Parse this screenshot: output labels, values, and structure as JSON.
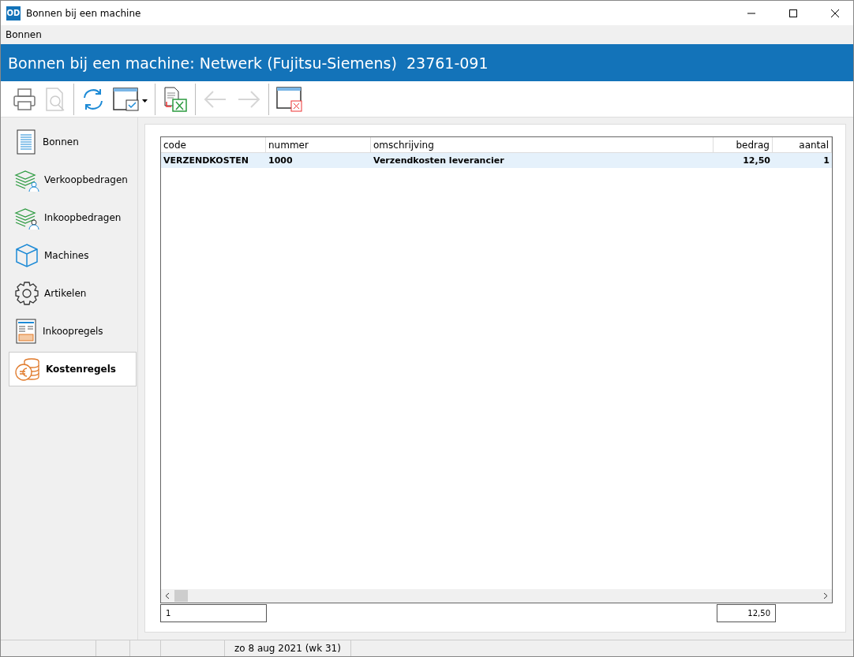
{
  "window": {
    "title": "Bonnen bij een machine",
    "app_badge": "OD"
  },
  "menu": [
    "Bonnen"
  ],
  "header": {
    "title": "Bonnen bij een machine: Netwerk (Fujitsu-Siemens)  23761-091"
  },
  "toolbar": [
    {
      "kind": "print",
      "disabled": false
    },
    {
      "kind": "preview",
      "disabled": true
    },
    {
      "kind": "sep"
    },
    {
      "kind": "refresh",
      "disabled": false
    },
    {
      "kind": "view",
      "disabled": false
    },
    {
      "kind": "sep"
    },
    {
      "kind": "excel",
      "disabled": false
    },
    {
      "kind": "sep"
    },
    {
      "kind": "back",
      "disabled": true
    },
    {
      "kind": "forward",
      "disabled": true
    },
    {
      "kind": "sep"
    },
    {
      "kind": "close",
      "disabled": false
    }
  ],
  "sidebar": {
    "items": [
      {
        "label": "Bonnen",
        "kind": "document",
        "selected": false
      },
      {
        "label": "Verkoopbedragen",
        "kind": "money-person",
        "selected": false
      },
      {
        "label": "Inkoopbedragen",
        "kind": "money-people",
        "selected": false
      },
      {
        "label": "Machines",
        "kind": "cube",
        "selected": false
      },
      {
        "label": "Artikelen",
        "kind": "gear",
        "selected": false
      },
      {
        "label": "Inkoopregels",
        "kind": "form",
        "selected": false
      },
      {
        "label": "Kostenregels",
        "kind": "coins",
        "selected": true
      }
    ]
  },
  "table": {
    "columns": [
      {
        "label": "code"
      },
      {
        "label": "nummer"
      },
      {
        "label": "omschrijving"
      },
      {
        "label": "bedrag"
      },
      {
        "label": "aantal"
      }
    ],
    "rows": [
      {
        "cells": [
          "VERZENDKOSTEN",
          "1000",
          "Verzendkosten leverancier",
          "12,50",
          "1"
        ],
        "selected": true
      }
    ]
  },
  "totals": {
    "count": "1",
    "amount": "12,50"
  },
  "status_bar": {
    "date": "zo 8 aug 2021 (wk 31)"
  }
}
